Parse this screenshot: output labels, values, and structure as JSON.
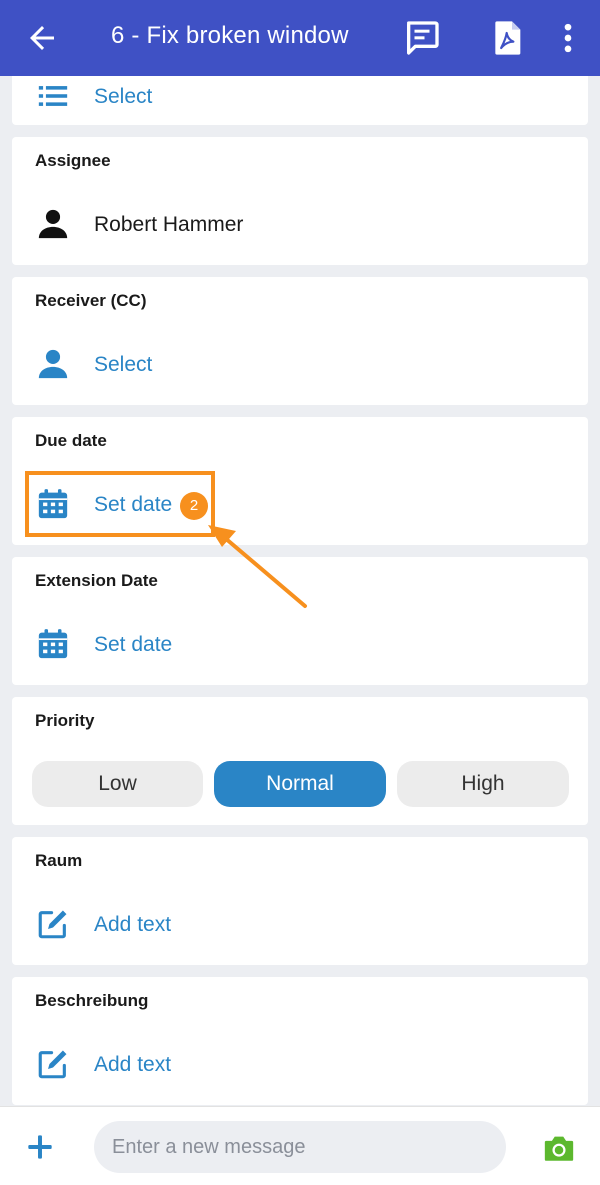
{
  "appbar": {
    "title": "6 - Fix broken window",
    "icons": [
      "back-arrow-icon",
      "chat-icon",
      "pdf-icon",
      "more-vert-icon"
    ]
  },
  "top_card": {
    "value": "Select"
  },
  "assignee": {
    "label": "Assignee",
    "value": "Robert Hammer"
  },
  "receiver": {
    "label": "Receiver (CC)",
    "value": "Select"
  },
  "due_date": {
    "label": "Due date",
    "value": "Set date",
    "badge": "2"
  },
  "extension_date": {
    "label": "Extension Date",
    "value": "Set date"
  },
  "priority": {
    "label": "Priority",
    "options": [
      "Low",
      "Normal",
      "High"
    ],
    "selected": "Normal"
  },
  "raum": {
    "label": "Raum",
    "value": "Add text"
  },
  "beschreibung": {
    "label": "Beschreibung",
    "value": "Add text"
  },
  "composer": {
    "placeholder": "Enter a new message"
  },
  "colors": {
    "appbar": "#3f51c5",
    "accent": "#2a85c6",
    "highlight": "#f7901e",
    "camera": "#5cb82e"
  }
}
